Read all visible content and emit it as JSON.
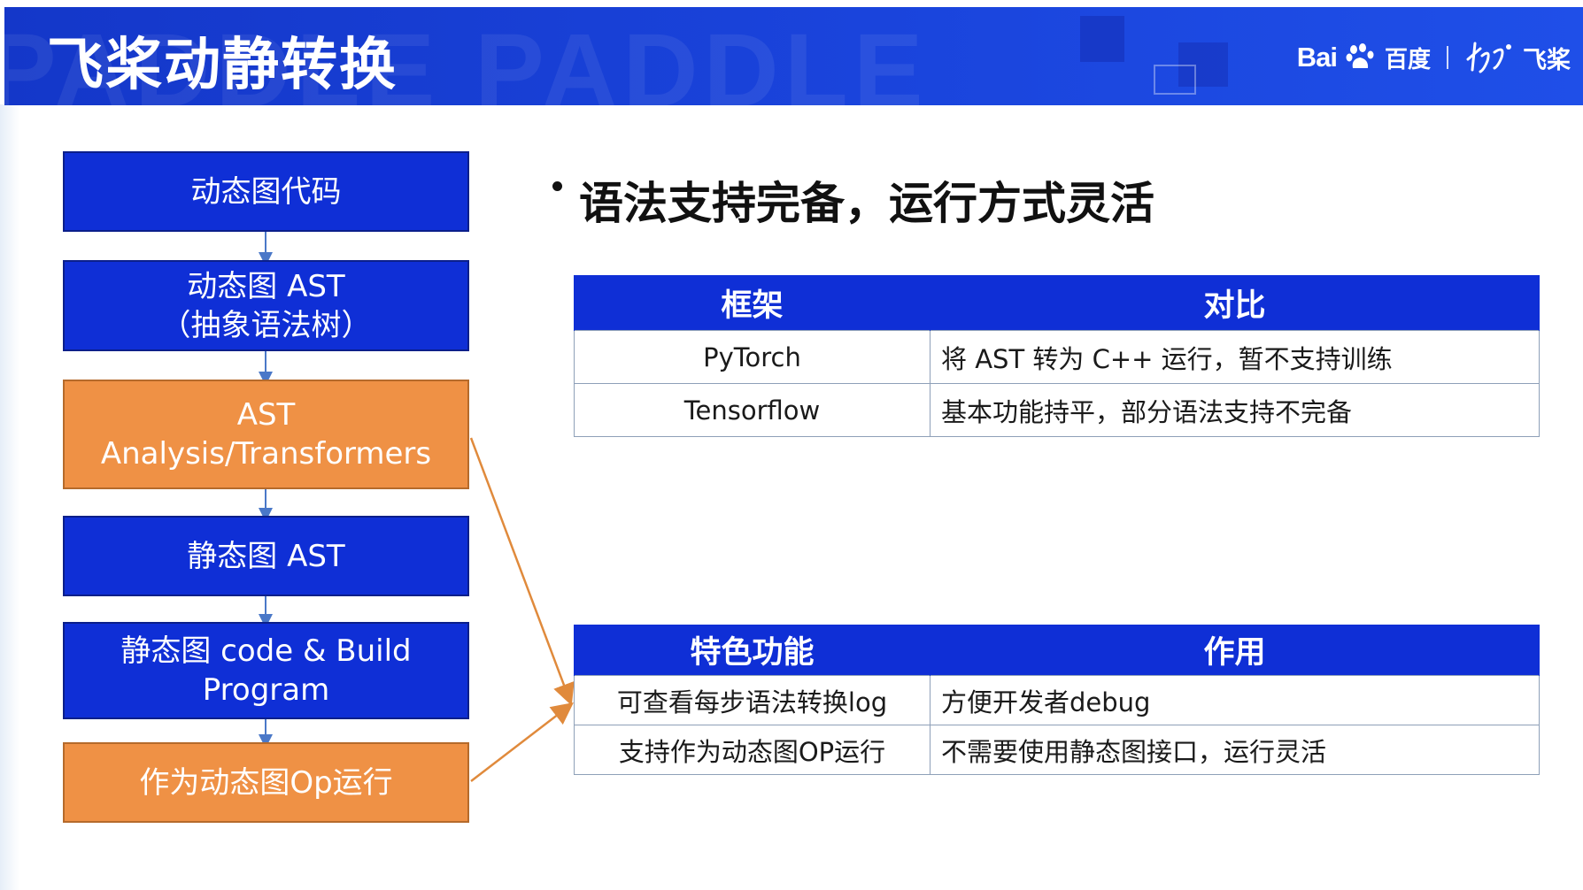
{
  "header": {
    "title": "飞桨动静转换",
    "watermark": "PADDLE PADDLE",
    "brand": {
      "baidu_text": "Bai",
      "baidu_sub": "百度",
      "paddle_text": "飞桨"
    }
  },
  "flow": {
    "box1": {
      "lines": [
        "动态图代码"
      ]
    },
    "box2": {
      "lines": [
        "动态图 AST",
        "（抽象语法树）"
      ]
    },
    "box3": {
      "lines": [
        "AST",
        "Analysis/Transformers"
      ]
    },
    "box4": {
      "lines": [
        "静态图 AST"
      ]
    },
    "box5": {
      "lines": [
        "静态图 code & Build",
        "Program"
      ]
    },
    "box6": {
      "lines": [
        "作为动态图Op运行"
      ]
    }
  },
  "bullet": "语法支持完备，运行方式灵活",
  "table1": {
    "headers": [
      "框架",
      "对比"
    ],
    "rows": [
      [
        "PyTorch",
        "将 AST 转为 C++ 运行，暂不支持训练"
      ],
      [
        "Tensorflow",
        "基本功能持平，部分语法支持不完备"
      ]
    ]
  },
  "table2": {
    "headers": [
      "特色功能",
      "作用"
    ],
    "rows": [
      [
        "可查看每步语法转换log",
        "方便开发者debug"
      ],
      [
        "支持作为动态图OP运行",
        "不需要使用静态图接口，运行灵活"
      ]
    ]
  },
  "colors": {
    "header_blue": "#1a44dc",
    "box_blue": "#0f2fd6",
    "box_orange": "#ef9145",
    "connector_blue": "#4a78c8",
    "connector_orange": "#e08a3c"
  },
  "icons": [
    "baidu-paw-icon",
    "paddle-logo-icon"
  ]
}
